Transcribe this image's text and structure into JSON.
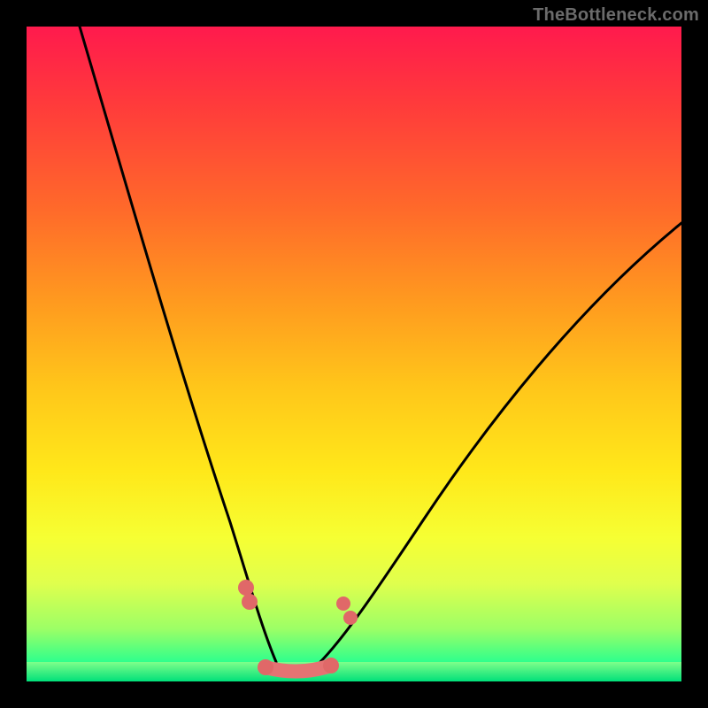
{
  "watermark": "TheBottleneck.com",
  "colors": {
    "frame": "#000000",
    "gradient_top": "#ff1a4d",
    "gradient_bottom": "#00e878",
    "curve": "#000000",
    "marker": "#e06868"
  },
  "chart_data": {
    "type": "line",
    "title": "",
    "xlabel": "",
    "ylabel": "",
    "xlim": [
      0,
      100
    ],
    "ylim": [
      0,
      100
    ],
    "grid": false,
    "legend": false,
    "series": [
      {
        "name": "left-arm",
        "x": [
          8,
          12,
          16,
          20,
          24,
          28,
          31,
          33,
          35,
          37,
          38
        ],
        "y": [
          100,
          82,
          64,
          48,
          34,
          22,
          12,
          6,
          3,
          1,
          0
        ]
      },
      {
        "name": "valley-floor",
        "x": [
          35,
          37,
          39,
          41,
          43,
          45,
          47
        ],
        "y": [
          2,
          0.5,
          0,
          0,
          0,
          0.5,
          2
        ]
      },
      {
        "name": "right-arm",
        "x": [
          44,
          47,
          52,
          58,
          64,
          72,
          80,
          88,
          96,
          100
        ],
        "y": [
          0,
          2,
          7,
          14,
          22,
          32,
          43,
          54,
          65,
          70
        ]
      }
    ],
    "markers": {
      "left_pair": [
        {
          "x": 33,
          "y": 12
        },
        {
          "x": 33.5,
          "y": 10
        }
      ],
      "right_pair": [
        {
          "x": 48,
          "y": 11
        },
        {
          "x": 49,
          "y": 9
        }
      ],
      "floor_segment": {
        "x0": 35,
        "x1": 47,
        "y": 1
      }
    }
  }
}
